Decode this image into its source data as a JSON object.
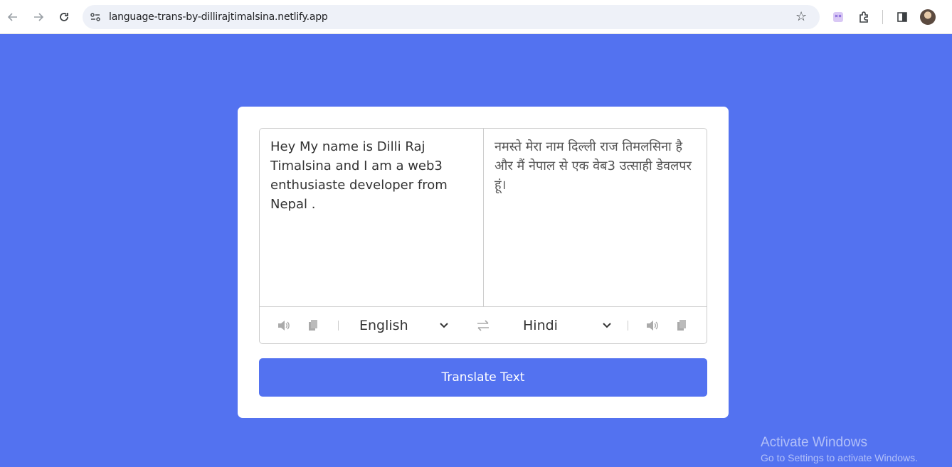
{
  "browser": {
    "url": "language-trans-by-dillirajtimalsina.netlify.app"
  },
  "translator": {
    "from_text": "Hey My name is Dilli Raj Timalsina and I am a web3 enthusiaste developer from Nepal .",
    "to_text": "नमस्ते मेरा नाम दिल्ली राज तिमलसिना है और मैं नेपाल से एक वेब3 उत्साही डेवलपर हूं।",
    "from_language": "English",
    "to_language": "Hindi",
    "translate_button": "Translate Text"
  },
  "watermark": {
    "title": "Activate Windows",
    "subtitle": "Go to Settings to activate Windows."
  },
  "colors": {
    "background": "#5372f0",
    "card": "#ffffff",
    "button": "#5372f0"
  }
}
